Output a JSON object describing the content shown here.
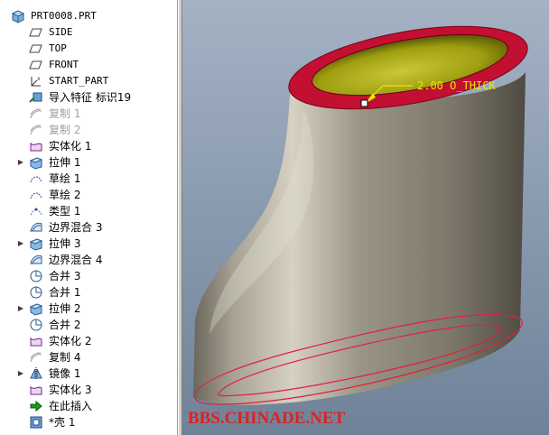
{
  "tree": {
    "root": "PRT0008.PRT",
    "items": [
      {
        "label": "SIDE",
        "icon": "datum-plane-icon"
      },
      {
        "label": "TOP",
        "icon": "datum-plane-icon"
      },
      {
        "label": "FRONT",
        "icon": "datum-plane-icon"
      },
      {
        "label": "START_PART",
        "icon": "coordinate-system-icon"
      },
      {
        "label": "导入特征 标识19",
        "icon": "import-feature-icon"
      },
      {
        "label": "复制 1",
        "icon": "copy-icon",
        "muted": true
      },
      {
        "label": "复制 2",
        "icon": "copy-icon",
        "muted": true
      },
      {
        "label": "实体化 1",
        "icon": "solidify-icon"
      },
      {
        "label": "拉伸 1",
        "icon": "extrude-icon",
        "expandable": true
      },
      {
        "label": "草绘 1",
        "icon": "sketch-icon"
      },
      {
        "label": "草绘 2",
        "icon": "sketch-icon"
      },
      {
        "label": "类型 1",
        "icon": "type-icon"
      },
      {
        "label": "边界混合 3",
        "icon": "boundary-blend-icon"
      },
      {
        "label": "拉伸 3",
        "icon": "extrude-icon",
        "expandable": true
      },
      {
        "label": "边界混合 4",
        "icon": "boundary-blend-icon"
      },
      {
        "label": "合并 3",
        "icon": "merge-icon"
      },
      {
        "label": "合并 1",
        "icon": "merge-icon"
      },
      {
        "label": "拉伸 2",
        "icon": "extrude-icon",
        "expandable": true
      },
      {
        "label": "合并 2",
        "icon": "merge-icon"
      },
      {
        "label": "实体化 2",
        "icon": "solidify-icon"
      },
      {
        "label": "复制 4",
        "icon": "copy-icon"
      },
      {
        "label": "镜像 1",
        "icon": "mirror-icon",
        "expandable": true
      },
      {
        "label": "实体化 3",
        "icon": "solidify-icon"
      },
      {
        "label": "在此插入",
        "icon": "insert-here-arrow-icon"
      },
      {
        "label": "*壳 1",
        "icon": "shell-icon"
      }
    ]
  },
  "viewport": {
    "dimension_label": "2.00 O_THICK",
    "watermark": "BBS.CHINADE.NET",
    "colors": {
      "background": "#8a9aae",
      "body": "#8c877a",
      "edge": "#d01030",
      "interior": "#c8c820",
      "dimension": "#e8e800",
      "watermark": "#e02020"
    }
  }
}
